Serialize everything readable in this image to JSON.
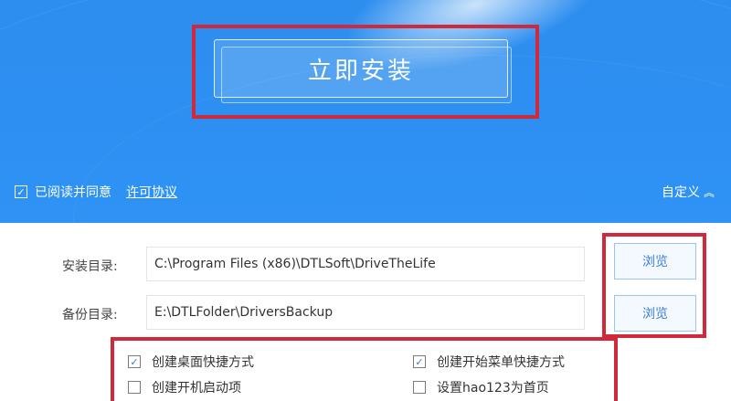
{
  "header": {
    "install_label": "立即安装",
    "agree": {
      "checked": true,
      "label": "已阅读并同意",
      "license_link": "许可协议"
    },
    "custom_label": "自定义"
  },
  "settings": {
    "install_dir": {
      "label": "安装目录:",
      "value": "C:\\Program Files (x86)\\DTLSoft\\DriveTheLife",
      "browse_label": "浏览"
    },
    "backup_dir": {
      "label": "备份目录:",
      "value": "E:\\DTLFolder\\DriversBackup",
      "browse_label": "浏览"
    }
  },
  "options": [
    {
      "label": "创建桌面快捷方式",
      "checked": true
    },
    {
      "label": "创建开始菜单快捷方式",
      "checked": true
    },
    {
      "label": "创建开机启动项",
      "checked": false
    },
    {
      "label": "设置hao123为首页",
      "checked": false
    }
  ],
  "colors": {
    "header_blue": "#2e8eef",
    "highlight_red": "#d0293a",
    "browse_text": "#3b7fd4"
  }
}
